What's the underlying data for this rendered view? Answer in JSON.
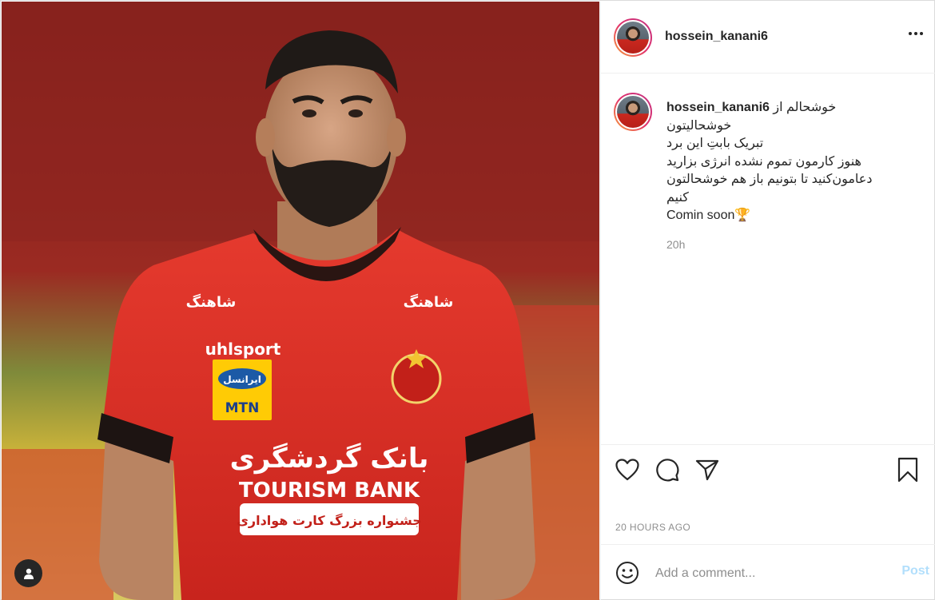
{
  "post": {
    "username": "hossein_kanani6",
    "caption": {
      "username": "hossein_kanani6",
      "first_line_text": "خوشحالم از",
      "lines": [
        "خوشحالیتون",
        "تبریک بابتِ این برد",
        "هنوز کارمون تموم نشده انرژی بزارید",
        "دعامون‌کنید تا بتونیم باز هم خوشحالتون",
        "کنیم"
      ],
      "last_line": "Comin soon",
      "last_line_emoji": "🏆",
      "relative_time": "20h"
    },
    "timestamp": "20 HOURS AGO",
    "comment": {
      "placeholder": "Add a comment...",
      "post_label": "Post"
    },
    "photo": {
      "jersey_sponsor_brand": "uhlsport",
      "jersey_sponsor_main": "TOURISM BANK",
      "jersey_sponsor_fa": "بانک گردشگری",
      "jersey_sponsor_sub": "جشنواره بزرگ کارت هواداری",
      "jersey_shoulder": "شاهنگ",
      "badge_fa": "ایرانسل",
      "badge_en": "MTN"
    },
    "icons": {
      "like": "heart-icon",
      "comment": "comment-icon",
      "share": "share-icon",
      "save": "bookmark-icon",
      "more": "more-options-icon",
      "emoji": "emoji-icon",
      "tag": "user-tag-icon"
    },
    "colors": {
      "jersey_red": "#d42a22",
      "post_button": "#b2dffc",
      "muted_text": "#8e8e8e"
    }
  }
}
